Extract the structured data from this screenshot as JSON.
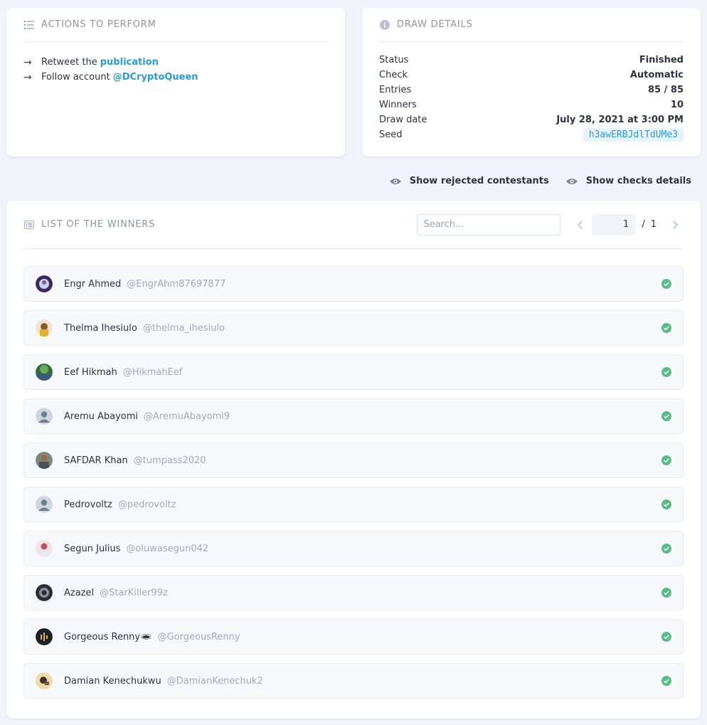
{
  "actions": {
    "title": "Actions to perform",
    "items": [
      {
        "text": "Retweet the",
        "link": "publication"
      },
      {
        "text": "Follow account",
        "link": "@DCryptoQueen"
      }
    ]
  },
  "details": {
    "title": "Draw details",
    "rows": [
      {
        "label": "Status",
        "value": "Finished"
      },
      {
        "label": "Check",
        "value": "Automatic"
      },
      {
        "label": "Entries",
        "value": "85 / 85"
      },
      {
        "label": "Winners",
        "value": "10"
      },
      {
        "label": "Draw date",
        "value": "July 28, 2021 at 3:00 PM"
      }
    ],
    "seed_label": "Seed",
    "seed_value": "h3awERBJdlTdUMe3"
  },
  "toggles": {
    "rejected": "Show rejected contestants",
    "checks": "Show checks details"
  },
  "winners": {
    "title": "List of the winners",
    "search_placeholder": "Search...",
    "page_current": "1",
    "page_sep": "/",
    "page_total": "1",
    "items": [
      {
        "name": "Engr Ahmed",
        "handle": "@EngrAhm87697877"
      },
      {
        "name": "Thelma Ihesiulo",
        "handle": "@thelma_ihesiulo"
      },
      {
        "name": "Eef Hikmah",
        "handle": "@HikmahEef"
      },
      {
        "name": "Aremu Abayomi",
        "handle": "@AremuAbayomi9"
      },
      {
        "name": "SAFDAR Khan",
        "handle": "@tumpass2020"
      },
      {
        "name": "Pedrovoltz",
        "handle": "@pedrovoltz"
      },
      {
        "name": "Segun Julius",
        "handle": "@oluwasegun042"
      },
      {
        "name": "Azazel",
        "handle": "@StarKiller99z"
      },
      {
        "name": "Gorgeous Renny🕳",
        "handle": "@GorgeousRenny"
      },
      {
        "name": "Damian Kenechukwu",
        "handle": "@DamianKenechuk2"
      }
    ]
  },
  "colors": {
    "accent": "#2b9bd6",
    "check_green": "#5dbb8a",
    "background": "#f1f5fb"
  }
}
